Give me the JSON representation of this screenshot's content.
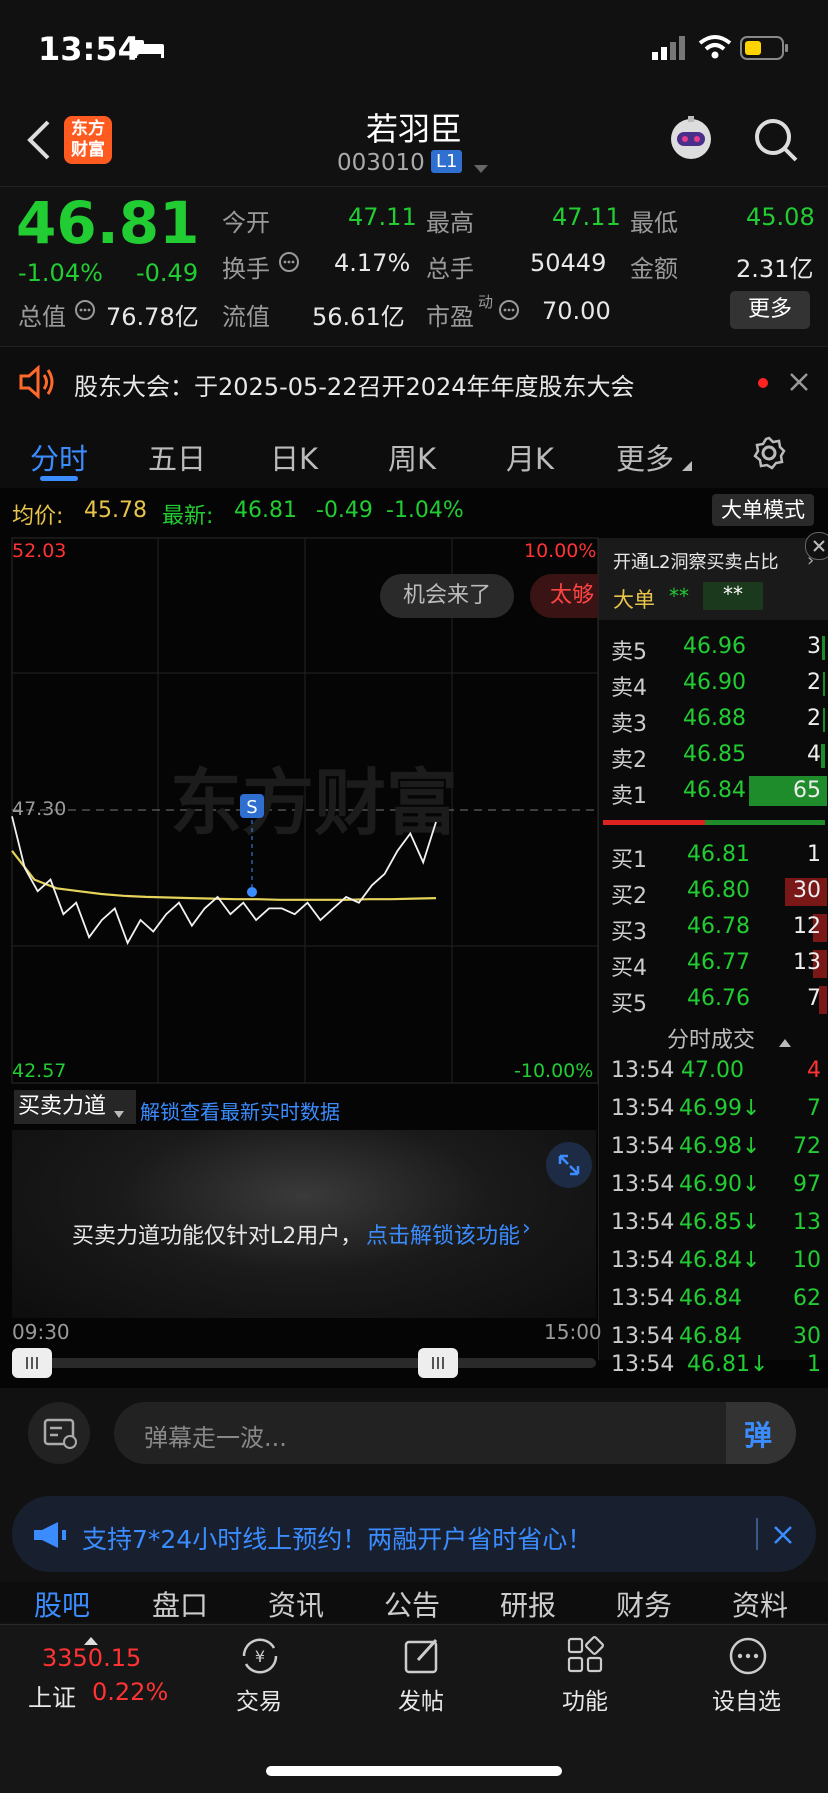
{
  "status_bar": {
    "time": "13:54"
  },
  "header": {
    "logo_text": "东方财富",
    "stock_name": "若羽臣",
    "stock_code": "003010",
    "level_badge": "L1"
  },
  "quote": {
    "price": "46.81",
    "change_pct": "-1.04%",
    "change": "-0.49",
    "open_label": "今开",
    "open": "47.11",
    "high_label": "最高",
    "high": "47.11",
    "low_label": "最低",
    "low": "45.08",
    "turnover_label": "换手",
    "turnover": "4.17%",
    "volume_label": "总手",
    "volume": "50449",
    "amount_label": "金额",
    "amount": "2.31亿",
    "mcap_label": "总值",
    "mcap": "76.78亿",
    "float_label": "流值",
    "float_cap": "56.61亿",
    "pe_label": "市盈",
    "pe_sup": "动",
    "pe": "70.00",
    "more_btn": "更多"
  },
  "notice": {
    "text": "股东大会：于2025-05-22召开2024年年度股东大会"
  },
  "tabs": [
    {
      "label": "分时",
      "active": true
    },
    {
      "label": "五日"
    },
    {
      "label": "日K"
    },
    {
      "label": "周K"
    },
    {
      "label": "月K"
    },
    {
      "label": "更多"
    }
  ],
  "chart_header": {
    "avg_label": "均价:",
    "avg": "45.78",
    "latest_label": "最新:",
    "latest": "46.81",
    "chg": "-0.49",
    "chg_pct": "-1.04%",
    "mode_btn": "大单模式"
  },
  "chart": {
    "y_max": "52.03",
    "y_mid": "47.30",
    "y_min": "42.57",
    "pct_max": "10.00%",
    "pct_min": "-10.00%",
    "t_start": "09:30",
    "t_end": "15:00",
    "watermark": "东方财富",
    "marker": "S",
    "bubble1": "机会来了",
    "bubble2": "太够"
  },
  "chart_data": {
    "type": "line",
    "x_range": [
      "09:30",
      "15:00"
    ],
    "ylim": [
      42.57,
      52.03
    ],
    "reference": 47.3,
    "series": [
      {
        "values": [
          47.2,
          46.3,
          45.9,
          46.1,
          45.5,
          45.7,
          45.1,
          45.4,
          45.6,
          45.0,
          45.4,
          45.2,
          45.5,
          45.7,
          45.3,
          45.6,
          45.8,
          45.5,
          45.7,
          45.4,
          45.6,
          45.6,
          45.5,
          45.7,
          45.4,
          45.6,
          45.8,
          45.7,
          46.0,
          46.2,
          46.6,
          46.9,
          46.4,
          47.1
        ]
      },
      {
        "values": [
          46.6,
          46.1,
          45.95,
          45.9,
          45.85,
          45.82,
          45.8,
          45.79,
          45.78,
          45.77,
          45.76,
          45.76,
          45.75,
          45.75,
          45.75,
          45.75,
          45.76,
          45.76,
          45.77,
          45.78
        ]
      }
    ]
  },
  "orderbook": {
    "l2_banner": "开通L2洞察买卖占比",
    "big_label": "大单",
    "stars1": "**",
    "stars2": "**",
    "asks": [
      {
        "label": "卖5",
        "price": "46.96",
        "vol": "3"
      },
      {
        "label": "卖4",
        "price": "46.90",
        "vol": "2"
      },
      {
        "label": "卖3",
        "price": "46.88",
        "vol": "2"
      },
      {
        "label": "卖2",
        "price": "46.85",
        "vol": "4"
      },
      {
        "label": "卖1",
        "price": "46.84",
        "vol": "65"
      }
    ],
    "bids": [
      {
        "label": "买1",
        "price": "46.81",
        "vol": "1"
      },
      {
        "label": "买2",
        "price": "46.80",
        "vol": "30"
      },
      {
        "label": "买3",
        "price": "46.78",
        "vol": "12"
      },
      {
        "label": "买4",
        "price": "46.77",
        "vol": "13"
      },
      {
        "label": "买5",
        "price": "46.76",
        "vol": "7"
      }
    ],
    "trades_title": "分时成交",
    "trades": [
      {
        "time": "13:54",
        "price": "47.00",
        "vol": "4",
        "dir": "up"
      },
      {
        "time": "13:54",
        "price": "46.99↓",
        "vol": "7",
        "dir": "down"
      },
      {
        "time": "13:54",
        "price": "46.98↓",
        "vol": "72",
        "dir": "down"
      },
      {
        "time": "13:54",
        "price": "46.90↓",
        "vol": "97",
        "dir": "down"
      },
      {
        "time": "13:54",
        "price": "46.85↓",
        "vol": "13",
        "dir": "down"
      },
      {
        "time": "13:54",
        "price": "46.84↓",
        "vol": "10",
        "dir": "down"
      },
      {
        "time": "13:54",
        "price": "46.84",
        "vol": "62",
        "dir": "down"
      },
      {
        "time": "13:54",
        "price": "46.84",
        "vol": "30",
        "dir": "down"
      },
      {
        "time": "13:54",
        "price": "46.81↓",
        "vol": "1",
        "dir": "down"
      }
    ]
  },
  "force": {
    "selector": "买卖力道",
    "unlock_link": "解锁查看最新实时数据",
    "desc": "买卖力道功能仅针对L2用户，",
    "desc_link": "点击解锁该功能"
  },
  "danmaku": {
    "placeholder": "弹幕走一波...",
    "send": "弹"
  },
  "ad": {
    "text": "支持7*24小时线上预约！两融开户省时省心！"
  },
  "sub_tabs": [
    "股吧",
    "盘口",
    "资讯",
    "公告",
    "研报",
    "财务",
    "资料"
  ],
  "bottom_nav": {
    "index_value": "3350.15",
    "index_name": "上证",
    "index_pct": "0.22%",
    "items": [
      "交易",
      "发帖",
      "功能",
      "设自选"
    ]
  }
}
